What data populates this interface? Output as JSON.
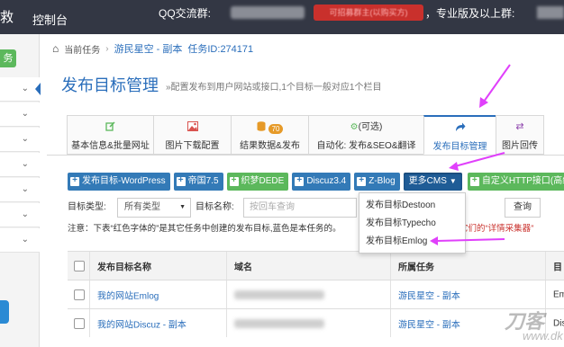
{
  "topbar": {
    "brand": "救",
    "console": "控制台",
    "qq_label": "QQ交流群:",
    "promo": "可招募群主(以购买方)",
    "pro_label": "，专业版及以上群:"
  },
  "sidebar": {
    "green_label": "务"
  },
  "breadcrumb": {
    "current_task_label": "当前任务",
    "task_name": "游民星空 - 副本",
    "task_id_label": "任务ID:",
    "task_id": "274171"
  },
  "page": {
    "title": "发布目标管理",
    "subtitle": "»配置发布到用户网站或接口,1个目标一般对应1个栏目"
  },
  "tabs": [
    {
      "label": "基本信息&批量网址",
      "icon": "edit-icon",
      "color": "#5cb85c"
    },
    {
      "label": "图片下载配置",
      "icon": "image-icon",
      "color": "#d9534f"
    },
    {
      "label": "结果数据&发布",
      "icon": "database-icon",
      "color": "#e69a28",
      "badge": "70"
    },
    {
      "label": "自动化: 发布&SEO&翻译",
      "icon": "gears-icon",
      "color": "#5cb85c",
      "top_label": "(可选)"
    },
    {
      "label": "发布目标管理",
      "icon": "share-icon",
      "color": "#2a6ebb",
      "active": true
    },
    {
      "label": "图片回传",
      "icon": "transfer-icon",
      "color": "#8e44ad"
    }
  ],
  "buttons": [
    {
      "label": "发布目标-WordPress",
      "style": "blue"
    },
    {
      "label": "帝国7.5",
      "style": "blue"
    },
    {
      "label": "织梦DEDE",
      "style": "green"
    },
    {
      "label": "Discuz3.4",
      "style": "blue"
    },
    {
      "label": "Z-Blog",
      "style": "blue"
    },
    {
      "label": "更多CMS",
      "style": "navy"
    },
    {
      "label": "自定义HTTP接口(高级)",
      "style": "green"
    }
  ],
  "filters": {
    "type_label": "目标类型:",
    "type_value": "所有类型",
    "name_label": "目标名称:",
    "name_placeholder": "按回车查询",
    "query_button": "查询"
  },
  "note": {
    "text_a": "注意：下表“红色字体的”是其它任务中创建的发布目标,蓝色是本任务的。",
    "text_b": "是它们的“详情采集器”"
  },
  "dropdown": {
    "items": [
      "发布目标Destoon",
      "发布目标Typecho",
      "发布目标Emlog"
    ]
  },
  "table": {
    "headers": [
      "发布目标名称",
      "域名",
      "所属任务",
      "目"
    ],
    "rows": [
      {
        "name": "我的网站Emlog",
        "task": "游民星空 - 副本",
        "extra": "Emlo"
      },
      {
        "name": "我的网站Discuz - 副本",
        "task": "游民星空 - 副本",
        "extra": "Disc"
      }
    ]
  },
  "watermark": {
    "line1": "刀客",
    "line2": "www.dk"
  },
  "colors": {
    "accent": "#2a6ebb",
    "topbar": "#333744",
    "arrow": "#e040fb"
  }
}
